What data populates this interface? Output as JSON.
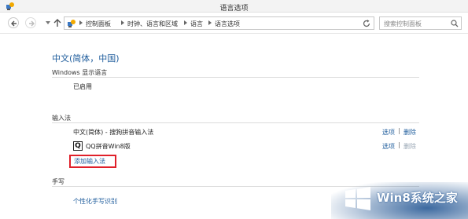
{
  "window": {
    "title": "语言选项"
  },
  "address_bar": {
    "crumbs": [
      "控制面板",
      "时钟、语言和区域",
      "语言",
      "语言选项"
    ]
  },
  "search": {
    "placeholder": "搜索控制面板"
  },
  "main": {
    "title": "中文(简体，中国)",
    "display_language": {
      "label": "Windows 显示语言",
      "status": "已启用"
    },
    "input_methods": {
      "label": "输入法",
      "items": [
        {
          "name": "中文(简体) - 搜狗拼音输入法",
          "options": "选项",
          "delete": "删除"
        },
        {
          "name": "QQ拼音Win8版",
          "options": "选项",
          "delete": "删除"
        }
      ],
      "add_link": "添加输入法"
    },
    "handwriting": {
      "label": "手写",
      "link": "个性化手写识别"
    }
  },
  "watermark": {
    "text": "Win8系统之家"
  },
  "colors": {
    "accent": "#1e5c9c",
    "highlight_border": "#e0202a",
    "watermark_blue": "#1a4f8f"
  },
  "icons": {
    "app": "control-panel-icon",
    "back": "back-arrow-icon",
    "forward": "forward-arrow-icon",
    "up": "up-arrow-icon",
    "refresh": "refresh-icon",
    "search": "search-icon",
    "qq": "qq-pinyin-icon",
    "logo": "windows-logo-icon"
  }
}
